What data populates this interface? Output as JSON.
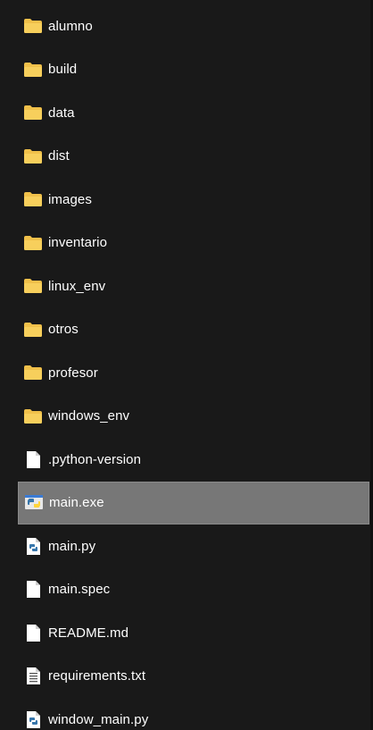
{
  "items": [
    {
      "label": "alumno",
      "icon": "folder-icon",
      "selected": false
    },
    {
      "label": "build",
      "icon": "folder-icon",
      "selected": false
    },
    {
      "label": "data",
      "icon": "folder-icon",
      "selected": false
    },
    {
      "label": "dist",
      "icon": "folder-icon",
      "selected": false
    },
    {
      "label": "images",
      "icon": "folder-icon",
      "selected": false
    },
    {
      "label": "inventario",
      "icon": "folder-icon",
      "selected": false
    },
    {
      "label": "linux_env",
      "icon": "folder-icon",
      "selected": false
    },
    {
      "label": "otros",
      "icon": "folder-icon",
      "selected": false
    },
    {
      "label": "profesor",
      "icon": "folder-icon",
      "selected": false
    },
    {
      "label": "windows_env",
      "icon": "folder-icon",
      "selected": false
    },
    {
      "label": ".python-version",
      "icon": "file-icon",
      "selected": false
    },
    {
      "label": "main.exe",
      "icon": "python-exe-icon",
      "selected": true
    },
    {
      "label": "main.py",
      "icon": "python-file-icon",
      "selected": false
    },
    {
      "label": "main.spec",
      "icon": "file-icon",
      "selected": false
    },
    {
      "label": "README.md",
      "icon": "file-icon",
      "selected": false
    },
    {
      "label": "requirements.txt",
      "icon": "text-file-icon",
      "selected": false
    },
    {
      "label": "window_main.py",
      "icon": "python-file-icon",
      "selected": false
    }
  ],
  "colors": {
    "background": "#191919",
    "text": "#ffffff",
    "folder": "#f0c04a",
    "selection": "#777777"
  }
}
